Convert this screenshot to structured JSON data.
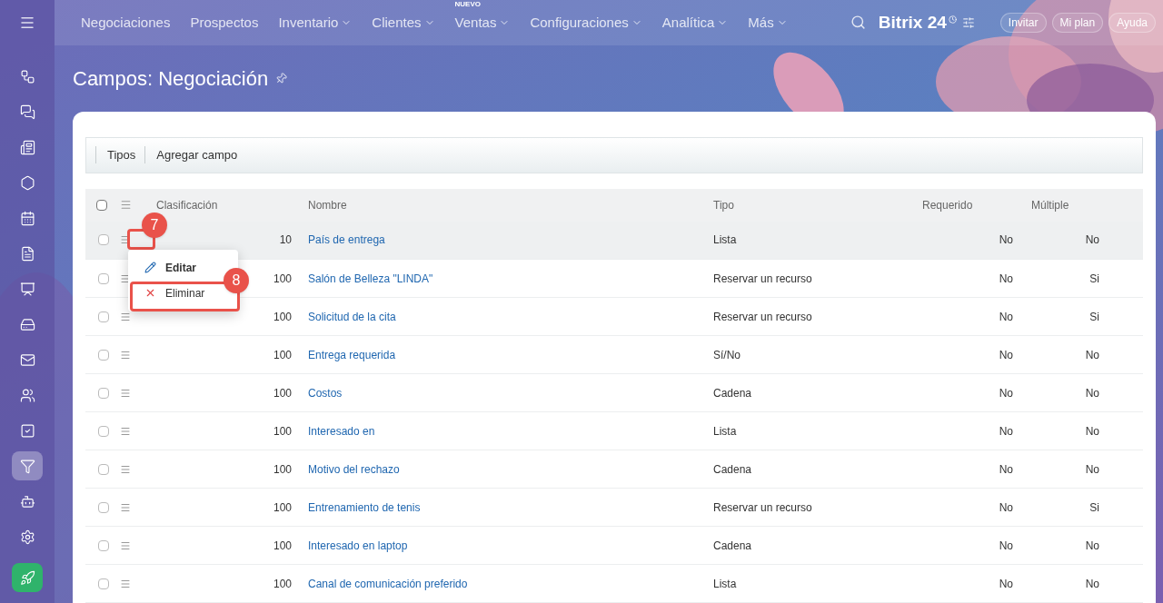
{
  "nav": {
    "items": [
      {
        "label": "Negociaciones",
        "has_menu": false
      },
      {
        "label": "Prospectos",
        "has_menu": false
      },
      {
        "label": "Inventario",
        "has_menu": true
      },
      {
        "label": "Clientes",
        "has_menu": true
      },
      {
        "label": "Ventas",
        "has_menu": true,
        "badge": "NUEVO"
      },
      {
        "label": "Configuraciones",
        "has_menu": true
      },
      {
        "label": "Analítica",
        "has_menu": true
      },
      {
        "label": "Más",
        "has_menu": true
      }
    ],
    "logo": "Bitrix 24",
    "buttons": [
      "Invitar",
      "Mi plan",
      "Ayuda"
    ]
  },
  "sidebar": {
    "items": [
      {
        "kind": "flow",
        "selected": false
      },
      {
        "kind": "chat",
        "selected": false
      },
      {
        "kind": "feed",
        "selected": false
      },
      {
        "kind": "hex",
        "selected": false
      },
      {
        "kind": "calendar",
        "selected": false
      },
      {
        "kind": "doc",
        "selected": false
      },
      {
        "kind": "board",
        "selected": false
      },
      {
        "kind": "drive",
        "selected": false
      },
      {
        "kind": "mail",
        "selected": false
      },
      {
        "kind": "people",
        "selected": false
      },
      {
        "kind": "task",
        "selected": false
      },
      {
        "kind": "funnel",
        "selected": true
      },
      {
        "kind": "bot",
        "selected": false
      },
      {
        "kind": "settings",
        "selected": false
      },
      {
        "kind": "rocket",
        "selected": false
      }
    ]
  },
  "page": {
    "title": "Campos: Negociación"
  },
  "toolbar": [
    "Tipos",
    "Agregar campo"
  ],
  "table": {
    "all_checked": false,
    "columns": [
      "Clasificación",
      "Nombre",
      "Tipo",
      "Requerido",
      "Múltiple"
    ],
    "rows": [
      {
        "sort": "10",
        "name": "País de entrega",
        "type": "Lista",
        "required": "No",
        "multiple": "No",
        "checked": false,
        "selected": true
      },
      {
        "sort": "100",
        "name": "Salón de Belleza \"LINDA\"",
        "type": "Reservar un recurso",
        "required": "No",
        "multiple": "Si",
        "checked": false,
        "selected": false
      },
      {
        "sort": "100",
        "name": "Solicitud de la cita",
        "type": "Reservar un recurso",
        "required": "No",
        "multiple": "Si",
        "checked": false,
        "selected": false
      },
      {
        "sort": "100",
        "name": "Entrega requerida",
        "type": "Sí/No",
        "required": "No",
        "multiple": "No",
        "checked": false,
        "selected": false
      },
      {
        "sort": "100",
        "name": "Costos",
        "type": "Cadena",
        "required": "No",
        "multiple": "No",
        "checked": false,
        "selected": false
      },
      {
        "sort": "100",
        "name": "Interesado en",
        "type": "Lista",
        "required": "No",
        "multiple": "No",
        "checked": false,
        "selected": false
      },
      {
        "sort": "100",
        "name": "Motivo del rechazo",
        "type": "Cadena",
        "required": "No",
        "multiple": "No",
        "checked": false,
        "selected": false
      },
      {
        "sort": "100",
        "name": "Entrenamiento de tenis",
        "type": "Reservar un recurso",
        "required": "No",
        "multiple": "Si",
        "checked": false,
        "selected": false
      },
      {
        "sort": "100",
        "name": "Interesado en laptop",
        "type": "Cadena",
        "required": "No",
        "multiple": "No",
        "checked": false,
        "selected": false
      },
      {
        "sort": "100",
        "name": "Canal de comunicación preferido",
        "type": "Lista",
        "required": "No",
        "multiple": "No",
        "checked": false,
        "selected": false
      }
    ]
  },
  "context_menu": {
    "items": [
      {
        "label": "Editar",
        "kind": "edit"
      },
      {
        "label": "Eliminar",
        "kind": "delete"
      }
    ]
  },
  "callouts": [
    "7",
    "8"
  ]
}
